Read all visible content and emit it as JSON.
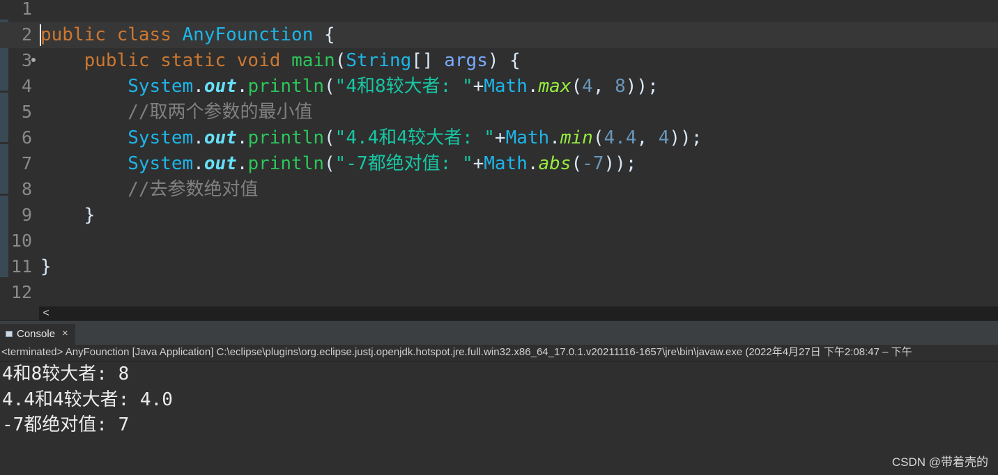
{
  "editor": {
    "lines": [
      {
        "num": "1",
        "tokens": []
      },
      {
        "num": "2",
        "tokens": [
          [
            "kw",
            "public"
          ],
          [
            "plain",
            " "
          ],
          [
            "kw",
            "class"
          ],
          [
            "plain",
            " "
          ],
          [
            "cls",
            "AnyFounction"
          ],
          [
            "plain",
            " {"
          ]
        ]
      },
      {
        "num": "3",
        "tokens": [
          [
            "plain",
            "    "
          ],
          [
            "kw",
            "public"
          ],
          [
            "plain",
            " "
          ],
          [
            "kw",
            "static"
          ],
          [
            "plain",
            " "
          ],
          [
            "kw",
            "void"
          ],
          [
            "plain",
            " "
          ],
          [
            "fn",
            "main"
          ],
          [
            "plain",
            "("
          ],
          [
            "cls",
            "String"
          ],
          [
            "plain",
            "[] "
          ],
          [
            "param",
            "args"
          ],
          [
            "plain",
            ") {"
          ]
        ]
      },
      {
        "num": "4",
        "tokens": [
          [
            "plain",
            "        "
          ],
          [
            "cls",
            "System"
          ],
          [
            "plain",
            "."
          ],
          [
            "field",
            "out"
          ],
          [
            "plain",
            "."
          ],
          [
            "fn",
            "println"
          ],
          [
            "plain",
            "("
          ],
          [
            "str",
            "\"4和8较大者: \""
          ],
          [
            "plain",
            "+"
          ],
          [
            "cls",
            "Math"
          ],
          [
            "plain",
            "."
          ],
          [
            "smeth",
            "max"
          ],
          [
            "plain",
            "("
          ],
          [
            "num",
            "4"
          ],
          [
            "plain",
            ", "
          ],
          [
            "num",
            "8"
          ],
          [
            "plain",
            "));"
          ]
        ]
      },
      {
        "num": "5",
        "tokens": [
          [
            "plain",
            "        "
          ],
          [
            "cmt",
            "//取两个参数的最小值"
          ]
        ]
      },
      {
        "num": "6",
        "tokens": [
          [
            "plain",
            "        "
          ],
          [
            "cls",
            "System"
          ],
          [
            "plain",
            "."
          ],
          [
            "field",
            "out"
          ],
          [
            "plain",
            "."
          ],
          [
            "fn",
            "println"
          ],
          [
            "plain",
            "("
          ],
          [
            "str",
            "\"4.4和4较大者: \""
          ],
          [
            "plain",
            "+"
          ],
          [
            "cls",
            "Math"
          ],
          [
            "plain",
            "."
          ],
          [
            "smeth",
            "min"
          ],
          [
            "plain",
            "("
          ],
          [
            "num",
            "4.4"
          ],
          [
            "plain",
            ", "
          ],
          [
            "num",
            "4"
          ],
          [
            "plain",
            "));"
          ]
        ]
      },
      {
        "num": "7",
        "tokens": [
          [
            "plain",
            "        "
          ],
          [
            "cls",
            "System"
          ],
          [
            "plain",
            "."
          ],
          [
            "field",
            "out"
          ],
          [
            "plain",
            "."
          ],
          [
            "fn",
            "println"
          ],
          [
            "plain",
            "("
          ],
          [
            "str",
            "\"-7都绝对值: \""
          ],
          [
            "plain",
            "+"
          ],
          [
            "cls",
            "Math"
          ],
          [
            "plain",
            "."
          ],
          [
            "smeth",
            "abs"
          ],
          [
            "plain",
            "("
          ],
          [
            "num",
            "-7"
          ],
          [
            "plain",
            "));"
          ]
        ]
      },
      {
        "num": "8",
        "tokens": [
          [
            "plain",
            "        "
          ],
          [
            "cmt",
            "//去参数绝对值"
          ]
        ]
      },
      {
        "num": "9",
        "tokens": [
          [
            "plain",
            "    }"
          ]
        ]
      },
      {
        "num": "10",
        "tokens": []
      },
      {
        "num": "11",
        "tokens": [
          [
            "plain",
            "}"
          ]
        ]
      },
      {
        "num": "12",
        "tokens": []
      }
    ]
  },
  "scrollbar": {
    "left_arrow": "<"
  },
  "console": {
    "tab_label": "Console",
    "close_glyph": "×",
    "status": "<terminated> AnyFounction [Java Application] C:\\eclipse\\plugins\\org.eclipse.justj.openjdk.hotspot.jre.full.win32.x86_64_17.0.1.v20211116-1657\\jre\\bin\\javaw.exe  (2022年4月27日 下午2:08:47 – 下午",
    "output": [
      "4和8较大者: 8",
      "4.4和4较大者: 4.0",
      "-7都绝对值: 7"
    ]
  },
  "watermark": "CSDN @带着壳的",
  "colors": {
    "background": "#2f2f2f",
    "keyword": "#cc7832",
    "class": "#1eb5e8",
    "method": "#2bc75a",
    "string": "#17c6a3",
    "number": "#6897bb",
    "comment": "#808080"
  }
}
